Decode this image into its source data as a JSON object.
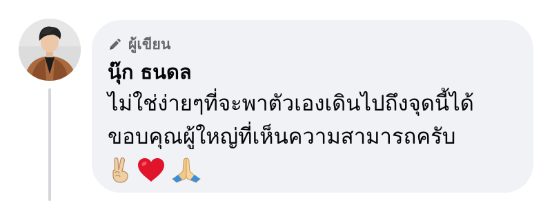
{
  "comment": {
    "badge_icon": "pencil-icon",
    "badge_label": "ผู้เขียน",
    "author_name": "นุ๊ก ธนดล",
    "message_lines": [
      "ไม่ใช่ง่ายๆที่จะพาตัวเองเดินไปถึงจุดนี้ได้",
      "ขอบคุณผู้ใหญ่ที่เห็นความสามารถครับ"
    ],
    "emojis": [
      "victory-hand-icon",
      "red-heart-icon",
      "folded-hands-icon"
    ]
  },
  "colors": {
    "bubble_bg": "#f0f2f5",
    "badge_text": "#65676b",
    "body_text": "#050505",
    "thread_line": "#d4d6da",
    "heart": "#e0142b"
  }
}
